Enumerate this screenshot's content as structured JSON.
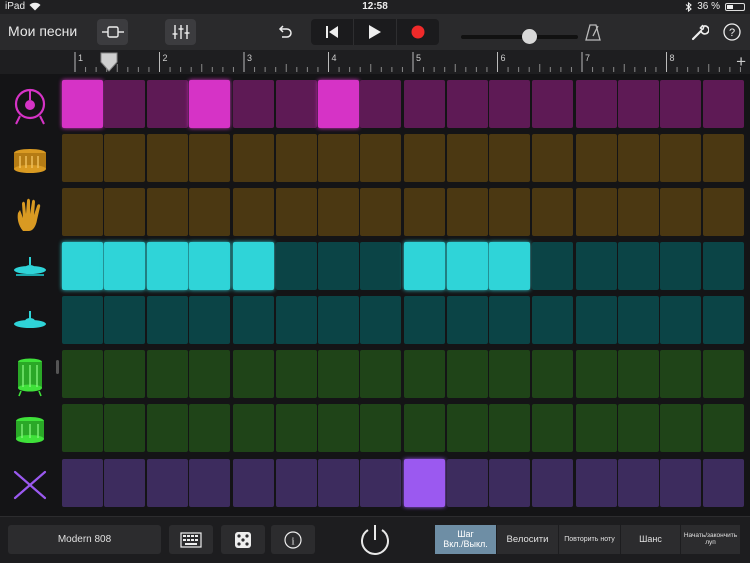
{
  "status_bar": {
    "device": "iPad",
    "time": "12:58",
    "battery": "36 %",
    "battery_fraction": 0.36,
    "icons": [
      "wifi-icon",
      "bluetooth-icon",
      "battery-icon"
    ]
  },
  "toolbar": {
    "title": "Мои песни",
    "icons": [
      "track-view-icon",
      "mixer-icon",
      "undo-icon",
      "go-to-start-icon",
      "play-icon",
      "record-icon",
      "metronome-icon",
      "wrench-icon",
      "help-icon"
    ],
    "volume_fraction": 0.6
  },
  "ruler": {
    "bars": [
      "1",
      "2",
      "3",
      "4",
      "5",
      "6",
      "7",
      "8"
    ],
    "add_label": "+"
  },
  "colors": {
    "magenta_on": "#d633c6",
    "magenta_off": "#5e1a55",
    "brown_off": "#4b3812",
    "cyan_on": "#2fd4d8",
    "cyan_off": "#0b4446",
    "green_off": "#1f4418",
    "purple_on": "#9b59f0",
    "purple_off": "#3d2c5e"
  },
  "rows": [
    {
      "instrument": "kick-drum-icon",
      "icon_color": "#d633c6",
      "on": "#d633c6",
      "off": "#5e1a55",
      "steps": [
        1,
        0,
        0,
        1,
        0,
        0,
        1,
        0,
        0,
        0,
        0,
        0,
        0,
        0,
        0,
        0
      ]
    },
    {
      "instrument": "snare-drum-icon",
      "icon_color": "#d99a22",
      "on": "#d99a22",
      "off": "#4b3812",
      "steps": [
        0,
        0,
        0,
        0,
        0,
        0,
        0,
        0,
        0,
        0,
        0,
        0,
        0,
        0,
        0,
        0
      ]
    },
    {
      "instrument": "clap-hand-icon",
      "icon_color": "#d99a22",
      "on": "#d99a22",
      "off": "#4b3812",
      "steps": [
        0,
        0,
        0,
        0,
        0,
        0,
        0,
        0,
        0,
        0,
        0,
        0,
        0,
        0,
        0,
        0
      ]
    },
    {
      "instrument": "closed-hihat-icon",
      "icon_color": "#2fd4d8",
      "on": "#2fd4d8",
      "off": "#0b4446",
      "steps": [
        1,
        1,
        1,
        1,
        1,
        0,
        0,
        0,
        1,
        1,
        1,
        0,
        0,
        0,
        0,
        0
      ]
    },
    {
      "instrument": "open-hihat-icon",
      "icon_color": "#2fd4d8",
      "on": "#2fd4d8",
      "off": "#0b4446",
      "steps": [
        0,
        0,
        0,
        0,
        0,
        0,
        0,
        0,
        0,
        0,
        0,
        0,
        0,
        0,
        0,
        0
      ]
    },
    {
      "instrument": "tom-high-icon",
      "icon_color": "#3fe13a",
      "on": "#3fe13a",
      "off": "#1f4418",
      "steps": [
        0,
        0,
        0,
        0,
        0,
        0,
        0,
        0,
        0,
        0,
        0,
        0,
        0,
        0,
        0,
        0
      ]
    },
    {
      "instrument": "tom-low-icon",
      "icon_color": "#3fe13a",
      "on": "#3fe13a",
      "off": "#1f4418",
      "steps": [
        0,
        0,
        0,
        0,
        0,
        0,
        0,
        0,
        0,
        0,
        0,
        0,
        0,
        0,
        0,
        0
      ]
    },
    {
      "instrument": "cowbell-sticks-icon",
      "icon_color": "#9b59f0",
      "on": "#9b59f0",
      "off": "#3d2c5e",
      "steps": [
        0,
        0,
        0,
        0,
        0,
        0,
        0,
        0,
        1,
        0,
        0,
        0,
        0,
        0,
        0,
        0
      ]
    }
  ],
  "bottom": {
    "kit_name": "Modern 808",
    "icons": [
      "pattern-keyboard-icon",
      "dice-icon",
      "info-icon",
      "power-icon"
    ],
    "modes": [
      {
        "line1": "Шаг",
        "line2": "Вкл./Выкл.",
        "active": true
      },
      {
        "line1": "Велосити",
        "line2": "",
        "active": false
      },
      {
        "line1": "Повторить ноту",
        "line2": "",
        "active": false
      },
      {
        "line1": "Шанс",
        "line2": "",
        "active": false
      },
      {
        "line1": "Начать/закончить",
        "line2": "луп",
        "active": false
      }
    ]
  }
}
